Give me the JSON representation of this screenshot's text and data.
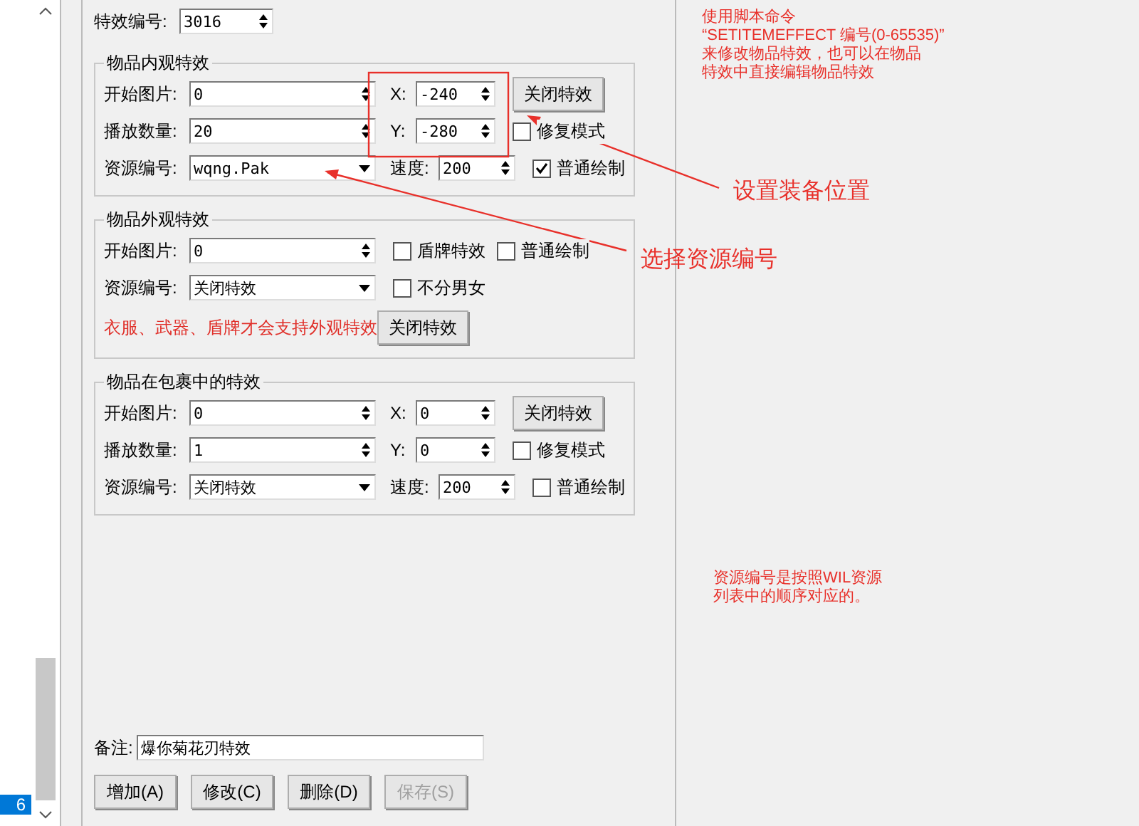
{
  "list": {
    "items": [
      {
        "label": "6",
        "selected": true
      }
    ]
  },
  "effect_id": {
    "label": "特效编号:",
    "value": "3016"
  },
  "groups": [
    {
      "kind": "positioned",
      "title": "物品内观特效",
      "start": {
        "label": "开始图片:",
        "value": "0"
      },
      "count": {
        "label": "播放数量:",
        "value": "20"
      },
      "resource": {
        "label": "资源编号:",
        "value": "wqng.Pak"
      },
      "x": {
        "label": "X:",
        "value": "-240"
      },
      "y": {
        "label": "Y:",
        "value": "-280"
      },
      "speed": {
        "label": "速度:",
        "value": "200"
      },
      "close_button": "关闭特效",
      "repair": {
        "label": "修复模式",
        "checked": false
      },
      "normal_draw": {
        "label": "普通绘制",
        "checked": true
      }
    },
    {
      "kind": "appearance",
      "title": "物品外观特效",
      "start": {
        "label": "开始图片:",
        "value": "0"
      },
      "resource": {
        "label": "资源编号:",
        "value": "关闭特效"
      },
      "shield": {
        "label": "盾牌特效",
        "checked": false
      },
      "normal_draw": {
        "label": "普通绘制",
        "checked": false
      },
      "unisex": {
        "label": "不分男女",
        "checked": false
      },
      "warning": "衣服、武器、盾牌才会支持外观特效",
      "close_button": "关闭特效"
    },
    {
      "kind": "positioned",
      "title": "物品在包裹中的特效",
      "start": {
        "label": "开始图片:",
        "value": "0"
      },
      "count": {
        "label": "播放数量:",
        "value": "1"
      },
      "resource": {
        "label": "资源编号:",
        "value": "关闭特效"
      },
      "x": {
        "label": "X:",
        "value": "0"
      },
      "y": {
        "label": "Y:",
        "value": "0"
      },
      "speed": {
        "label": "速度:",
        "value": "200"
      },
      "close_button": "关闭特效",
      "repair": {
        "label": "修复模式",
        "checked": false
      },
      "normal_draw": {
        "label": "普通绘制",
        "checked": false
      }
    }
  ],
  "remark": {
    "label": "备注:",
    "value": "爆你菊花刃特效"
  },
  "buttons": [
    {
      "label": "增加(A)",
      "disabled": false
    },
    {
      "label": "修改(C)",
      "disabled": false
    },
    {
      "label": "删除(D)",
      "disabled": false
    },
    {
      "label": "保存(S)",
      "disabled": true
    }
  ],
  "notes": [
    "使用脚本命令",
    "“SETITEMEFFECT  编号(0-65535)”",
    "来修改物品特效，也可以在物品",
    "特效中直接编辑物品特效"
  ],
  "bottom_note": [
    "资源编号是按照WIL资源",
    "列表中的顺序对应的。"
  ],
  "annotations": [
    {
      "text": "设置装备位置"
    },
    {
      "text": "选择资源编号"
    }
  ]
}
